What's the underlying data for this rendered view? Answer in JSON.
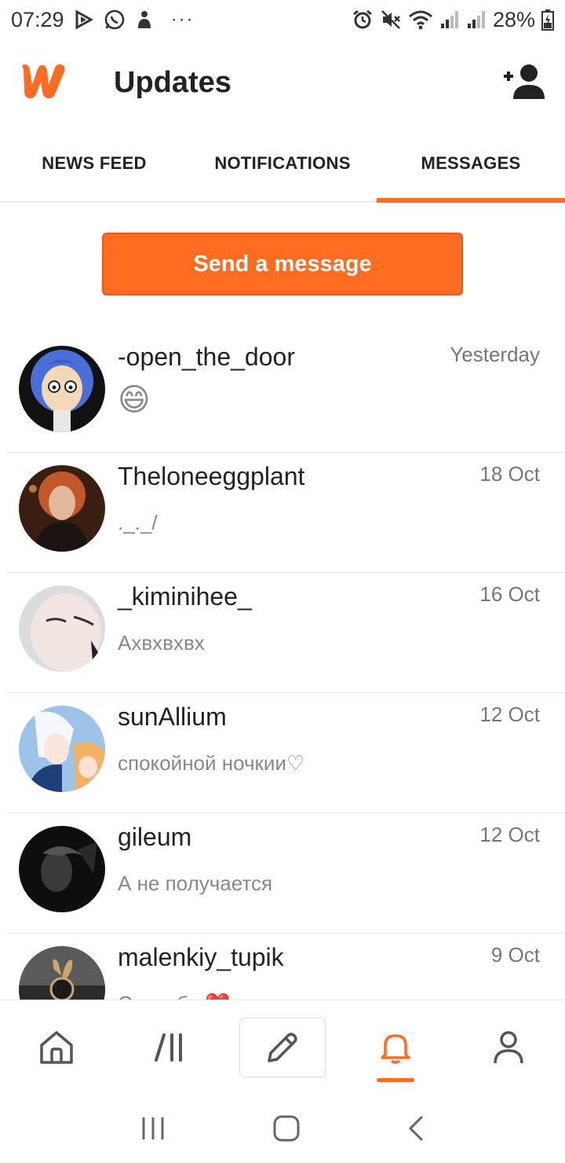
{
  "status_bar": {
    "time": "07:29",
    "battery": "28%",
    "overflow": "···"
  },
  "header": {
    "title": "Updates"
  },
  "tabs": [
    {
      "label": "NEWS FEED",
      "active": false
    },
    {
      "label": "NOTIFICATIONS",
      "active": false
    },
    {
      "label": "MESSAGES",
      "active": true
    }
  ],
  "send_button": {
    "label": "Send a message"
  },
  "messages": [
    {
      "name": "-open_the_door",
      "preview": "😄",
      "date": "Yesterday"
    },
    {
      "name": "Theloneeggplant",
      "preview": "._._/",
      "date": "18 Oct"
    },
    {
      "name": "_kiminihee_",
      "preview": "Ахвхвхвх",
      "date": "16 Oct"
    },
    {
      "name": "sunAllium",
      "preview": "спокойной ночкии♡",
      "date": "12 Oct"
    },
    {
      "name": "gileum",
      "preview": "А не получается",
      "date": "12 Oct"
    },
    {
      "name": "malenkiy_tupik",
      "preview": "Спасибо ❤️",
      "date": "9 Oct"
    }
  ],
  "colors": {
    "accent": "#ff6c22",
    "text": "#222222",
    "muted": "#888888"
  },
  "bottom_nav": [
    {
      "icon": "home-icon",
      "active": false
    },
    {
      "icon": "library-icon",
      "active": false
    },
    {
      "icon": "pencil-icon",
      "active": false
    },
    {
      "icon": "bell-icon",
      "active": true
    },
    {
      "icon": "profile-icon",
      "active": false
    }
  ]
}
